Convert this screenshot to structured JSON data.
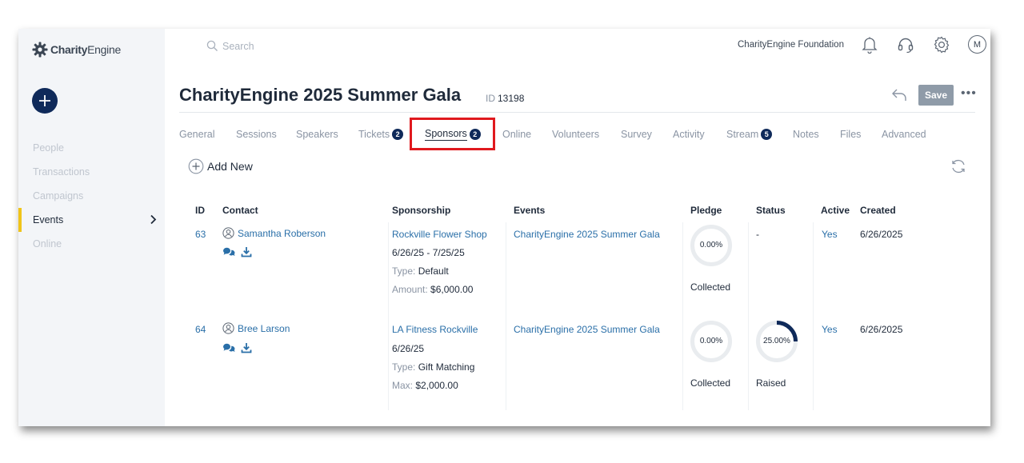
{
  "app": {
    "logo_bold": "Charity",
    "logo_rest": "Engine"
  },
  "topbar": {
    "search_placeholder": "Search",
    "org_name": "CharityEngine Foundation",
    "avatar_initial": "M"
  },
  "sidebar": {
    "items": [
      {
        "label": "People",
        "active": false
      },
      {
        "label": "Transactions",
        "active": false
      },
      {
        "label": "Campaigns",
        "active": false
      },
      {
        "label": "Events",
        "active": true
      },
      {
        "label": "Online",
        "active": false
      }
    ]
  },
  "page": {
    "title": "CharityEngine 2025 Summer Gala",
    "id_label": "ID",
    "id_value": "13198",
    "save_label": "Save",
    "more_label": "•••",
    "add_new_label": "Add New"
  },
  "tabs": [
    {
      "label": "General",
      "badge": null
    },
    {
      "label": "Sessions",
      "badge": null
    },
    {
      "label": "Speakers",
      "badge": null
    },
    {
      "label": "Tickets",
      "badge": "2"
    },
    {
      "label": "Sponsors",
      "badge": "2",
      "active": true
    },
    {
      "label": "Online",
      "badge": null
    },
    {
      "label": "Volunteers",
      "badge": null
    },
    {
      "label": "Survey",
      "badge": null
    },
    {
      "label": "Activity",
      "badge": null
    },
    {
      "label": "Stream",
      "badge": "5"
    },
    {
      "label": "Notes",
      "badge": null
    },
    {
      "label": "Files",
      "badge": null
    },
    {
      "label": "Advanced",
      "badge": null
    }
  ],
  "table": {
    "headers": {
      "id": "ID",
      "contact": "Contact",
      "sponsorship": "Sponsorship",
      "events": "Events",
      "pledge": "Pledge",
      "status": "Status",
      "active": "Active",
      "created": "Created"
    },
    "rows": [
      {
        "id": "63",
        "contact": "Samantha Roberson",
        "sponsor_name": "Rockville Flower Shop",
        "dates": "6/26/25 - 7/25/25",
        "type_label": "Type:",
        "type_value": "Default",
        "amount_label": "Amount:",
        "amount_value": "$6,000.00",
        "event": "CharityEngine 2025 Summer Gala",
        "pledge_pct": "0.00%",
        "pledge_fraction": 0,
        "pledge_caption": "Collected",
        "status_text": "-",
        "status_pct": null,
        "status_fraction": null,
        "status_caption": null,
        "active": "Yes",
        "created": "6/26/2025"
      },
      {
        "id": "64",
        "contact": "Bree Larson",
        "sponsor_name": "LA Fitness Rockville",
        "dates": "6/26/25",
        "type_label": "Type:",
        "type_value": "Gift Matching",
        "amount_label": "Max:",
        "amount_value": "$2,000.00",
        "event": "CharityEngine 2025 Summer Gala",
        "pledge_pct": "0.00%",
        "pledge_fraction": 0,
        "pledge_caption": "Collected",
        "status_text": null,
        "status_pct": "25.00%",
        "status_fraction": 0.25,
        "status_caption": "Raised",
        "active": "Yes",
        "created": "6/26/2025"
      }
    ]
  },
  "colors": {
    "navy": "#0f2a5a",
    "link": "#2a6fa8",
    "highlight": "#e0191e",
    "nav_accent": "#f0c419",
    "ring_track": "#e9ecef"
  },
  "icons": {
    "logo": "gear-logo-icon",
    "add": "plus-icon",
    "search": "search-icon",
    "bell": "bell-icon",
    "support": "headset-icon",
    "settings": "gear-icon",
    "back": "back-arrow-icon",
    "refresh": "refresh-icon",
    "contact": "person-icon",
    "chat": "chat-icon",
    "download": "download-icon"
  }
}
